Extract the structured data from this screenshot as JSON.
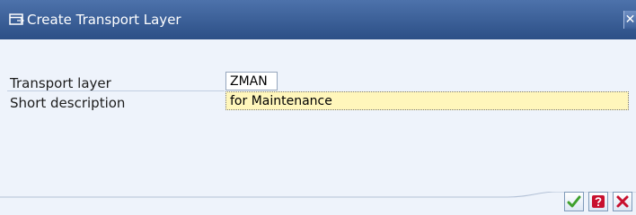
{
  "dialog": {
    "title": "Create Transport Layer",
    "close_glyph": "✕"
  },
  "form": {
    "transport_layer": {
      "label": "Transport layer",
      "value": "ZMAN"
    },
    "short_description": {
      "label": "Short description",
      "value": "for Maintenance"
    }
  },
  "icons": {
    "title": "dialog-window-icon",
    "ok": "green-check-icon",
    "help": "red-question-icon",
    "cancel": "red-x-icon"
  },
  "colors": {
    "titlebar": "#2c4f86",
    "background": "#eef3fb",
    "required_field": "#fff6bb",
    "ok": "#3ea02c",
    "help": "#c8102e",
    "cancel": "#c8102e"
  }
}
